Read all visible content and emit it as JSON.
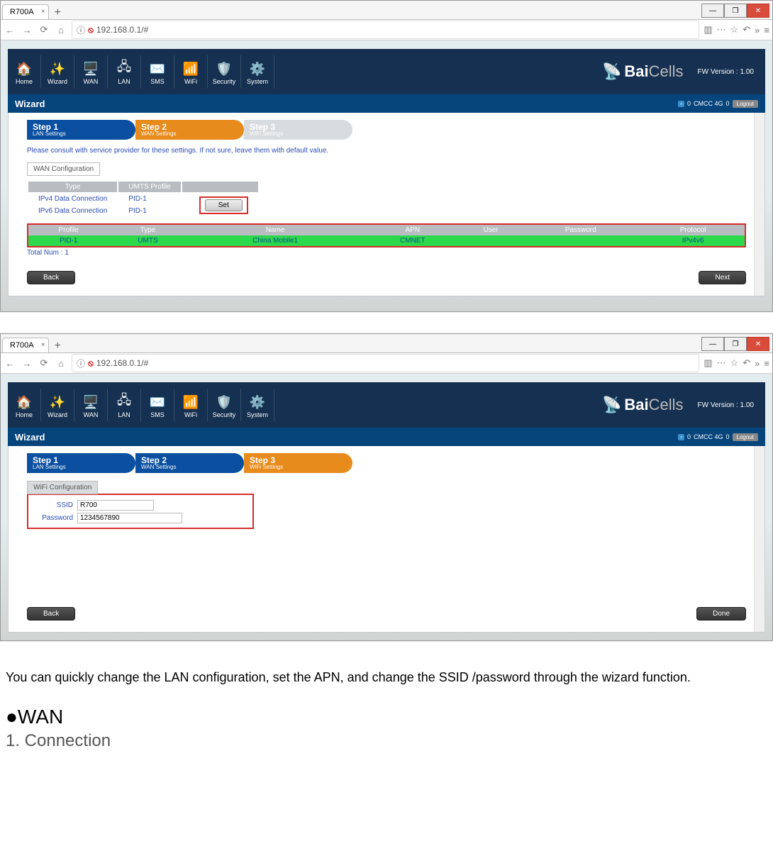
{
  "browser": {
    "tab_title": "R700A",
    "url": "192.168.0.1/#",
    "window_buttons": {
      "min": "—",
      "max": "❐",
      "close": "✕"
    }
  },
  "app": {
    "nav": [
      "Home",
      "Wizard",
      "WAN",
      "LAN",
      "SMS",
      "WiFi",
      "Security",
      "System"
    ],
    "brand": "BaiCells",
    "fw": "FW Version : 1.00",
    "page_title": "Wizard",
    "status": {
      "carrier": "CMCC  4G",
      "count1": "0",
      "count2": "0",
      "logout": "Logout"
    }
  },
  "shot1": {
    "steps": [
      {
        "title": "Step 1",
        "sub": "LAN Settings",
        "cls": "s-blue"
      },
      {
        "title": "Step 2",
        "sub": "WAN Settings",
        "cls": "s-orange"
      },
      {
        "title": "Step 3",
        "sub": "WiFi Settings",
        "cls": "s-off"
      }
    ],
    "hint": "Please consult with service provider for these settings. If not sure, leave them with default value.",
    "tab_label": "WAN Configuration",
    "cfg_head": [
      "Type",
      "UMTS Profile"
    ],
    "cfg_rows": [
      {
        "type": "IPv4 Data Connection",
        "prof": "PID-1"
      },
      {
        "type": "IPv6 Data Connection",
        "prof": "PID-1"
      }
    ],
    "set_btn": "Set",
    "profile_head": [
      "Profile",
      "Type",
      "Name",
      "APN",
      "User",
      "Password",
      "Protocol"
    ],
    "profile_row": [
      "PID-1",
      "UMTS",
      "China Mobile1",
      "CMNET",
      "",
      "",
      "IPv4v6"
    ],
    "total": "Total Num : 1",
    "back": "Back",
    "next": "Next"
  },
  "shot2": {
    "steps": [
      {
        "title": "Step 1",
        "sub": "LAN Settings",
        "cls": "s-blue"
      },
      {
        "title": "Step 2",
        "sub": "WAN Settings",
        "cls": "s-blue"
      },
      {
        "title": "Step 3",
        "sub": "WiFi Settings",
        "cls": "s-orange"
      }
    ],
    "tab_label": "WiFi Configuration",
    "ssid_label": "SSID",
    "ssid_val": "R700",
    "pw_label": "Password",
    "pw_val": "1234567890",
    "back": "Back",
    "done": "Done"
  },
  "doc": {
    "para": "You can quickly change the LAN configuration, set the APN, and change the SSID /password through the wizard function.",
    "h2": "●WAN",
    "h3": "1. Connection"
  }
}
